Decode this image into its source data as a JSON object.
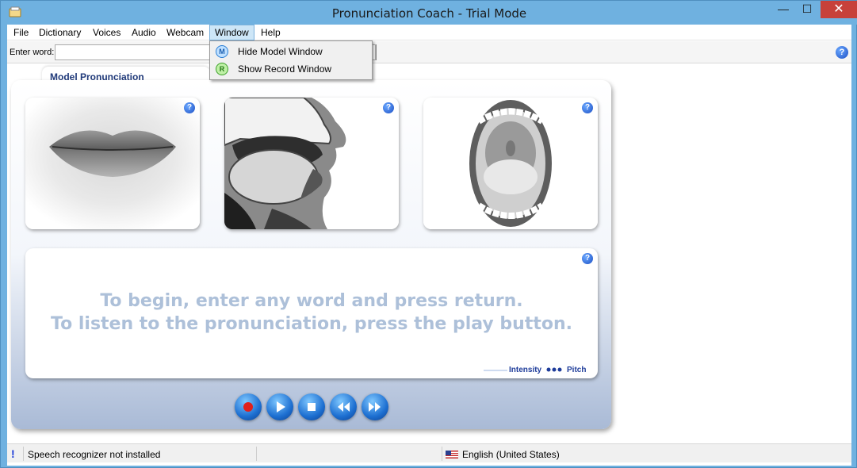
{
  "window": {
    "title": "Pronunciation Coach - Trial Mode",
    "controls": {
      "minimize": "—",
      "maximize": "☐",
      "close": "✕"
    }
  },
  "menubar": {
    "items": [
      "File",
      "Dictionary",
      "Voices",
      "Audio",
      "Webcam",
      "Window",
      "Help"
    ],
    "active": "Window"
  },
  "window_menu": {
    "items": [
      {
        "label": "Hide Model Window",
        "icon": "M"
      },
      {
        "label": "Show Record Window",
        "icon": "R"
      }
    ]
  },
  "toolbar": {
    "word_label": "Enter word:",
    "word_value": ""
  },
  "panel": {
    "tab_label": "Model Pronunciation",
    "message_line1": "To begin, enter any word and press return.",
    "message_line2": "To listen to the pronunciation, press the play button.",
    "legend_intensity": "Intensity",
    "legend_pitch": "Pitch",
    "cards": [
      "lips-view",
      "mouth-cross-section",
      "open-mouth-view"
    ],
    "help_glyph": "?"
  },
  "controls": [
    "record",
    "play",
    "stop",
    "rewind",
    "fast-forward"
  ],
  "statusbar": {
    "warning_glyph": "!",
    "message": "Speech recognizer not installed",
    "language": "English (United States)"
  },
  "colors": {
    "titlebar": "#6fb1e0",
    "accent_blue": "#1d6fd1",
    "message_text": "#adc0d9",
    "close_button": "#c7413a"
  }
}
